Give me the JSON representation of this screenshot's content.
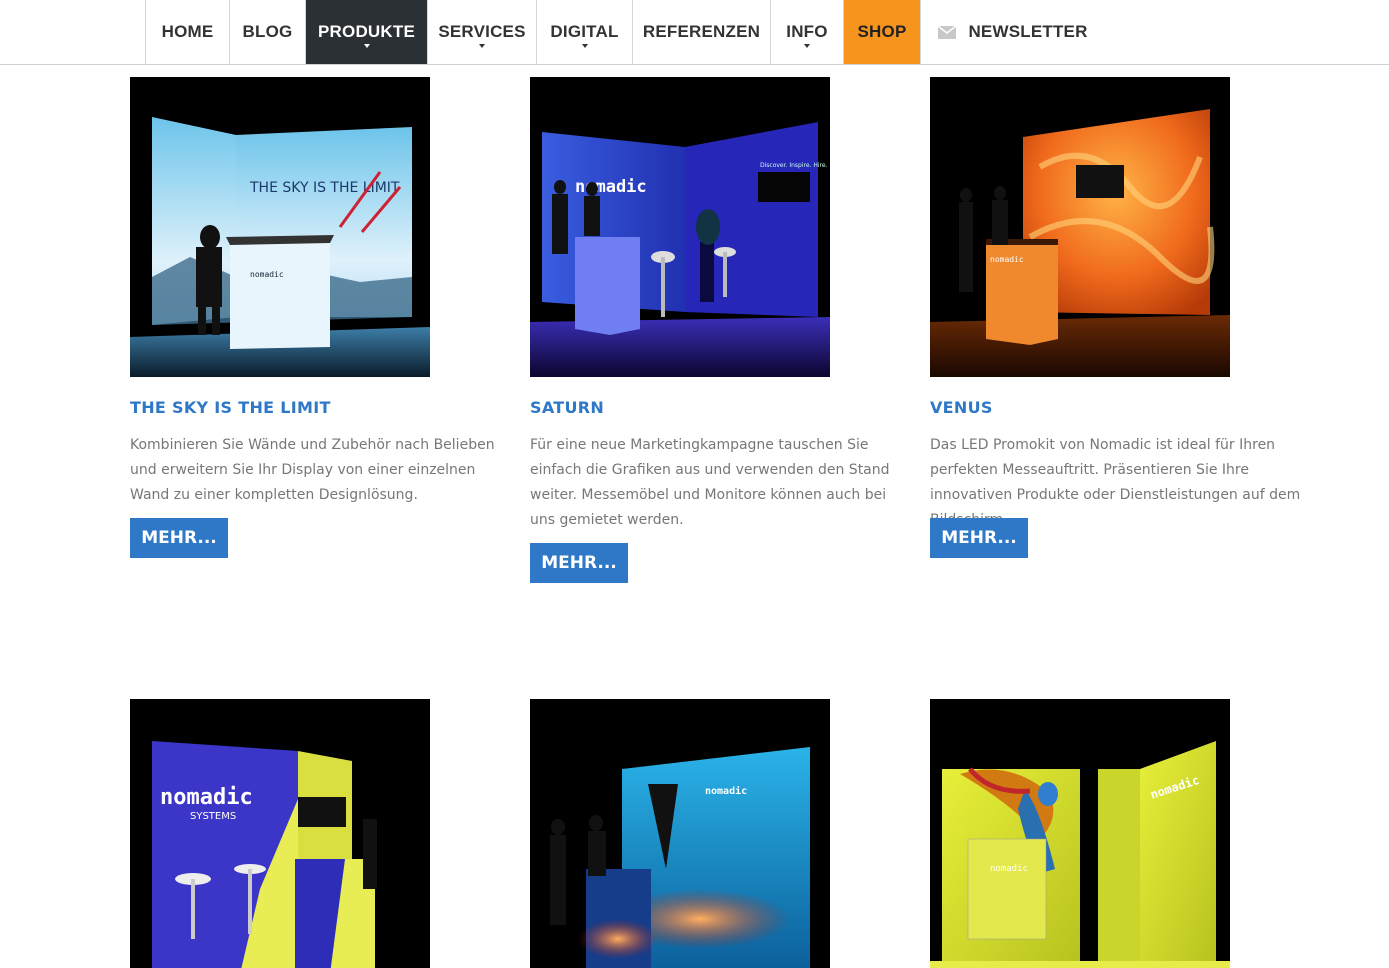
{
  "nav": {
    "items": [
      {
        "label": "HOME"
      },
      {
        "label": "BLOG"
      },
      {
        "label": "PRODUKTE"
      },
      {
        "label": "SERVICES"
      },
      {
        "label": "DIGITAL"
      },
      {
        "label": "REFERENZEN"
      },
      {
        "label": "INFO"
      },
      {
        "label": "SHOP"
      },
      {
        "label": "NEWSLETTER"
      }
    ]
  },
  "products": [
    {
      "title": "THE SKY IS THE LIMIT",
      "text": "Kombinieren Sie Wände und Zubehör nach Belieben und erweitern Sie Ihr Display von einer einzelnen Wand zu einer kompletten Designlösung.",
      "button": "MEHR...",
      "image_text": "THE SKY IS THE LIMIT"
    },
    {
      "title": "SATURN",
      "text": "Für eine neue Marketingkampagne tauschen Sie einfach die Grafiken aus und verwenden den Stand weiter. Mes­se­möbel und Monitore können auch bei uns gemietet werden.",
      "button": "MEHR...",
      "image_text": "Discover. Inspire. Hire."
    },
    {
      "title": "VENUS",
      "text": "Das LED Promokit von Nomadic ist ideal für Ihren per­fekten Messeauftritt. Präsentieren Sie Ihre innovativen Produkte oder Dienstleistungen auf dem Bildschirm.",
      "button": "MEHR..."
    }
  ],
  "brand": {
    "logo_word": "nomadic",
    "logo_sub": "SYSTEMS"
  },
  "colors": {
    "accent": "#2f78c8",
    "nav_active": "#2b3035",
    "shop": "#f7941d"
  }
}
